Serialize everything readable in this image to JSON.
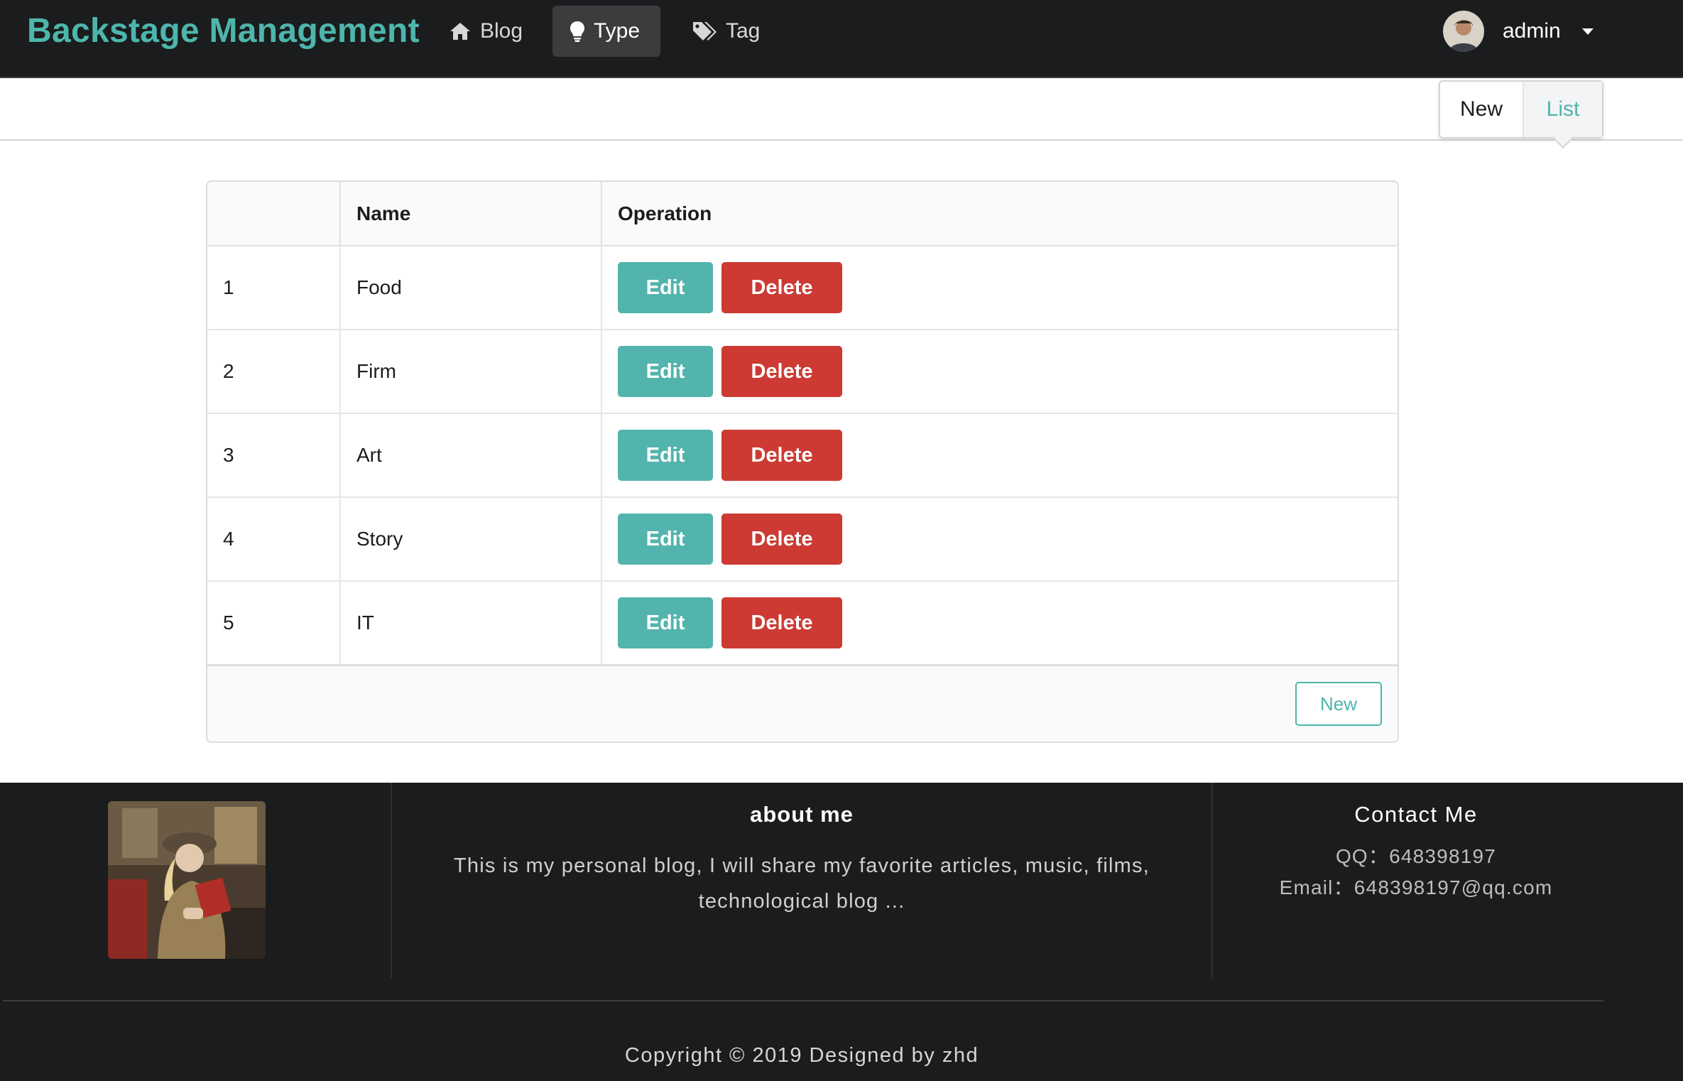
{
  "header": {
    "brand": "Backstage Management",
    "nav": [
      {
        "label": "Blog",
        "icon": "home-icon"
      },
      {
        "label": "Type",
        "icon": "lightbulb-icon",
        "active": true
      },
      {
        "label": "Tag",
        "icon": "tags-icon"
      }
    ],
    "user": {
      "name": "admin"
    }
  },
  "submenu": {
    "new_label": "New",
    "list_label": "List",
    "active": "List"
  },
  "table": {
    "columns": [
      "",
      "Name",
      "Operation"
    ],
    "rows": [
      {
        "id": "1",
        "name": "Food"
      },
      {
        "id": "2",
        "name": "Firm"
      },
      {
        "id": "3",
        "name": "Art"
      },
      {
        "id": "4",
        "name": "Story"
      },
      {
        "id": "5",
        "name": "IT"
      }
    ],
    "edit_label": "Edit",
    "delete_label": "Delete",
    "new_label": "New"
  },
  "footer": {
    "about_title": "about me",
    "about_text": "This is my personal blog, I will share my favorite articles, music, films, technological blog ...",
    "contact_title": "Contact Me",
    "qq": "QQ：648398197",
    "email": "Email：648398197@qq.com",
    "copyright": "Copyright © 2019 Designed by zhd"
  },
  "colors": {
    "accent": "#4db6ac",
    "edit_button": "#52b4ad",
    "delete_button": "#cc3a33",
    "dark_bg": "#1b1c1d"
  }
}
